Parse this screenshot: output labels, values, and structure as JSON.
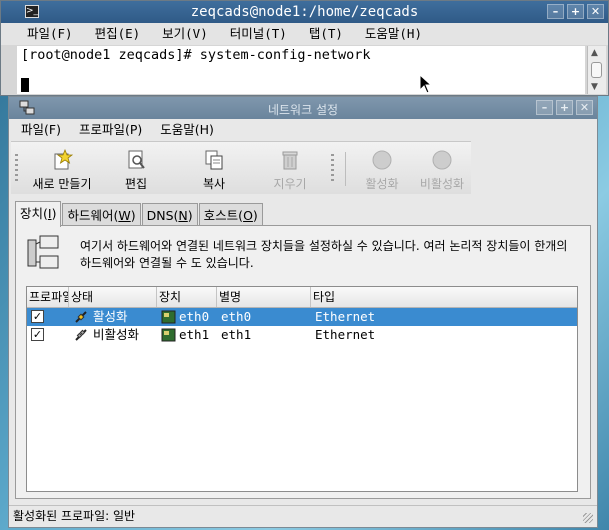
{
  "terminal": {
    "title": "zeqcads@node1:/home/zeqcads",
    "menu": [
      "파일(F)",
      "편집(E)",
      "보기(V)",
      "터미널(T)",
      "탭(T)",
      "도움말(H)"
    ],
    "prompt_line": "[root@node1 zeqcads]# system-config-network"
  },
  "network_window": {
    "title": "네트워크 설정",
    "menu": [
      "파일(F)",
      "프로파일(P)",
      "도움말(H)"
    ],
    "toolbar": {
      "new": "새로 만들기",
      "edit": "편집",
      "copy": "복사",
      "delete": "지우기",
      "activate": "활성화",
      "deactivate": "비활성화"
    },
    "tabs": [
      {
        "pre": "장치(",
        "key": "I",
        "post": ")"
      },
      {
        "pre": "하드웨어(",
        "key": "W",
        "post": ")"
      },
      {
        "pre": "DNS(",
        "key": "N",
        "post": ")"
      },
      {
        "pre": "호스트(",
        "key": "O",
        "post": ")"
      }
    ],
    "help_text": "여기서 하드웨어와 연결된 네트워크 장치들을 설정하실 수 있습니다.    여러 논리적 장치들이 한개의 하드웨어와 연결될 수 도 있습니다.",
    "table": {
      "columns": [
        "프로파일",
        "상태",
        "장치",
        "별명",
        "타입"
      ],
      "rows": [
        {
          "profile_checked": true,
          "status": "활성화",
          "device": "eth0",
          "alias": "eth0",
          "type": "Ethernet",
          "selected": true
        },
        {
          "profile_checked": true,
          "status": "비활성화",
          "device": "eth1",
          "alias": "eth1",
          "type": "Ethernet",
          "selected": false
        }
      ]
    },
    "status_bar": "활성화된 프로파일:  일반"
  },
  "colors": {
    "title_active": "#2f5a87",
    "title_inactive": "#7f97ad",
    "selection": "#3a8bd0"
  }
}
